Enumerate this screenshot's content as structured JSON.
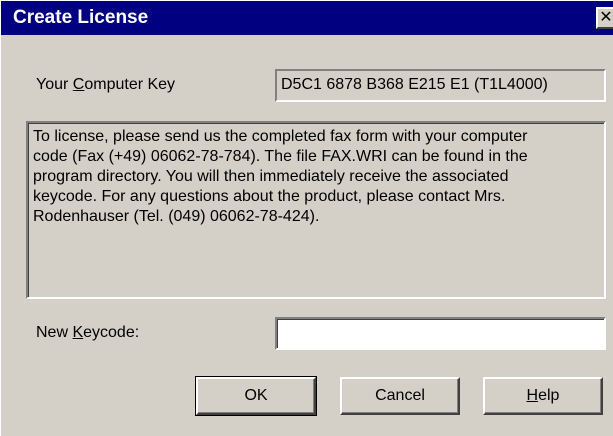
{
  "window": {
    "title": "Create License",
    "close_glyph": "✕"
  },
  "computer_key": {
    "label_before": "Your ",
    "label_accel": "C",
    "label_after": "omputer Key",
    "value": "D5C1 6878 B368 E215 E1 (T1L4000)"
  },
  "info": {
    "lines": [
      "To license, please send us the completed fax form with your computer",
      "code (Fax (+49) 06062-78-784). The file FAX.WRI can be found in the",
      "program directory. You will then immediately receive the associated",
      "keycode. For any questions about the product, please contact Mrs.",
      "Rodenhauser (Tel. (049) 06062-78-424)."
    ]
  },
  "new_keycode": {
    "label_before": "New ",
    "label_accel": "K",
    "label_after": "eycode:",
    "value": "",
    "placeholder": ""
  },
  "buttons": {
    "ok": "OK",
    "cancel": "Cancel",
    "help_accel": "H",
    "help_rest": "elp"
  }
}
